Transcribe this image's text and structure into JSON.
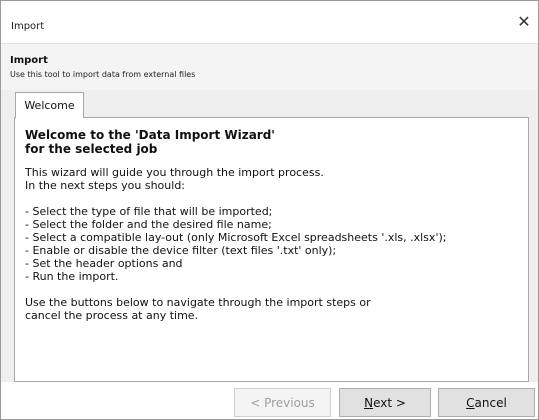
{
  "window": {
    "title": "Import",
    "close_glyph": "✕"
  },
  "header": {
    "title": "Import",
    "subtitle": "Use this tool to import data from external files"
  },
  "tabs": [
    {
      "label": "Welcome",
      "selected": true
    }
  ],
  "welcome": {
    "title_line1": "Welcome to the 'Data Import Wizard'",
    "title_line2": "for the selected job",
    "intro_line1": "This wizard will guide you through the import process.",
    "intro_line2": "In the next steps you should:",
    "steps": [
      "- Select the type of file that will be imported;",
      "- Select the folder and the desired file name;",
      "- Select a compatible lay-out (only Microsoft Excel spreadsheets '.xls, .xlsx');",
      "- Enable or disable the device filter (text files '.txt' only);",
      "- Set the header options and",
      "- Run the import."
    ],
    "outro_line1": "Use the buttons below to navigate through the import steps or",
    "outro_line2": "cancel the process at any time."
  },
  "buttons": {
    "previous": "< Previous",
    "next": "Next >",
    "cancel": "Cancel"
  },
  "colors": {
    "header_bg": "#f4f4f4",
    "content_bg": "#efefef",
    "button_bg": "#e1e1e1",
    "disabled_text": "#9f9f9f"
  }
}
